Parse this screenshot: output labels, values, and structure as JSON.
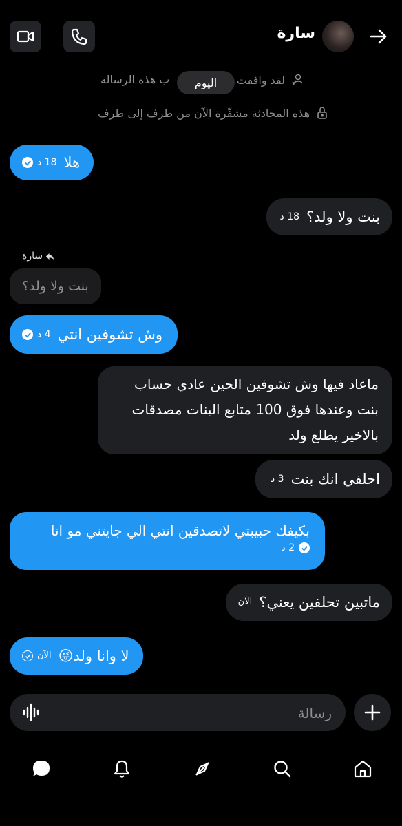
{
  "header": {
    "contact_name": "سارة",
    "video_icon": "video-camera-icon",
    "call_icon": "phone-icon",
    "back_icon": "arrow-right-icon"
  },
  "system": {
    "accepted_text": "لقد وافقت على طلب هذه الرسالة",
    "accepted_text_visible": "لقد وافقت",
    "accepted_tail": "ب هذه الرسالة",
    "today_label": "اليوم",
    "encrypted_text": "هذه المحادثة مشفّرة الآن من طرف إلى طرف"
  },
  "messages": [
    {
      "dir": "out",
      "text": "هلا",
      "time": "18 د"
    },
    {
      "dir": "in",
      "text": "بنت ولا ولد؟",
      "time": "18 د"
    },
    {
      "reply_label": "سارة",
      "reply_text": "بنت ولا ولد؟"
    },
    {
      "dir": "out",
      "text": "وش تشوفين انتي",
      "time": "4 د"
    },
    {
      "dir": "in",
      "lines": [
        "ماعاد فيها وش تشوفين الحين عادي حساب",
        "بنت وعندها فوق 100 متابع البنات مصدقات",
        "بالاخير يطلع ولد"
      ]
    },
    {
      "dir": "in",
      "text": "احلفي انك بنت",
      "time": "3 د"
    },
    {
      "dir": "out",
      "text": "بكيفك حبيبتي لاتصدقين انتي الي جايتني مو انا",
      "time": "2 د"
    },
    {
      "dir": "in",
      "text": "ماتبين تحلفين يعني؟",
      "time": "الآن"
    },
    {
      "dir": "out",
      "text": "لا وانا ولد😜",
      "time": "الآن"
    }
  ],
  "composer": {
    "placeholder": "رسالة",
    "voice_icon": "waveform-icon",
    "add_icon": "plus-icon"
  },
  "nav": {
    "items": [
      "home-icon",
      "search-icon",
      "compass-icon",
      "bell-icon",
      "chat-icon"
    ]
  },
  "colors": {
    "outgoing": "#2196f3",
    "incoming": "#1f2023",
    "background": "#000000"
  }
}
